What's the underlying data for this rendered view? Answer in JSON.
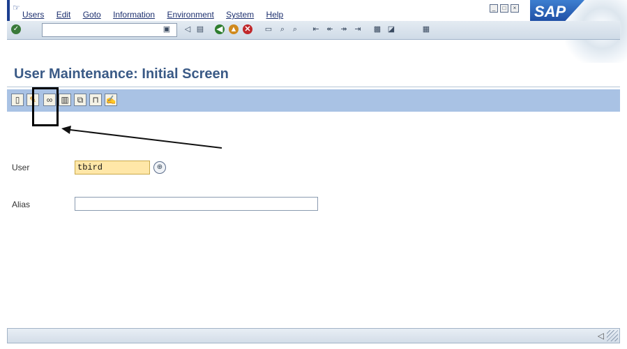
{
  "menubar": {
    "items": [
      "Users",
      "Edit",
      "Goto",
      "Information",
      "Environment",
      "System",
      "Help"
    ],
    "logo_text": "SAP"
  },
  "toolbar": {
    "ok_icon": "check-circle-icon",
    "command_field_value": ""
  },
  "title": "User Maintenance: Initial Screen",
  "app_toolbar": {
    "buttons": [
      "create-icon",
      "change-pencil-icon",
      "display-glasses-icon",
      "delete-icon",
      "copy-icon",
      "lock-icon",
      "edit-doc-icon"
    ]
  },
  "form": {
    "user_label": "User",
    "user_value": "tbird",
    "alias_label": "Alias",
    "alias_value": ""
  },
  "colors": {
    "app_toolbar": "#a9c2e4",
    "user_input_bg": "#ffe7a8",
    "title": "#3a5a86"
  }
}
